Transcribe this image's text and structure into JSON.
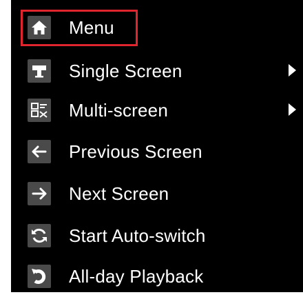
{
  "menu": {
    "items": [
      {
        "label": "Menu",
        "icon": "home-icon",
        "has_submenu": false,
        "highlighted": true
      },
      {
        "label": "Single Screen",
        "icon": "single-screen-icon",
        "has_submenu": true
      },
      {
        "label": "Multi-screen",
        "icon": "multi-screen-icon",
        "has_submenu": true
      },
      {
        "label": "Previous Screen",
        "icon": "arrow-left-icon",
        "has_submenu": false
      },
      {
        "label": "Next Screen",
        "icon": "arrow-right-icon",
        "has_submenu": false
      },
      {
        "label": "Start Auto-switch",
        "icon": "refresh-icon",
        "has_submenu": false
      },
      {
        "label": "All-day Playback",
        "icon": "playback-icon",
        "has_submenu": false
      }
    ]
  },
  "colors": {
    "background": "#000000",
    "text": "#ffffff",
    "highlight_border": "#e0252f",
    "icon_tile": "#4a4a4a"
  }
}
